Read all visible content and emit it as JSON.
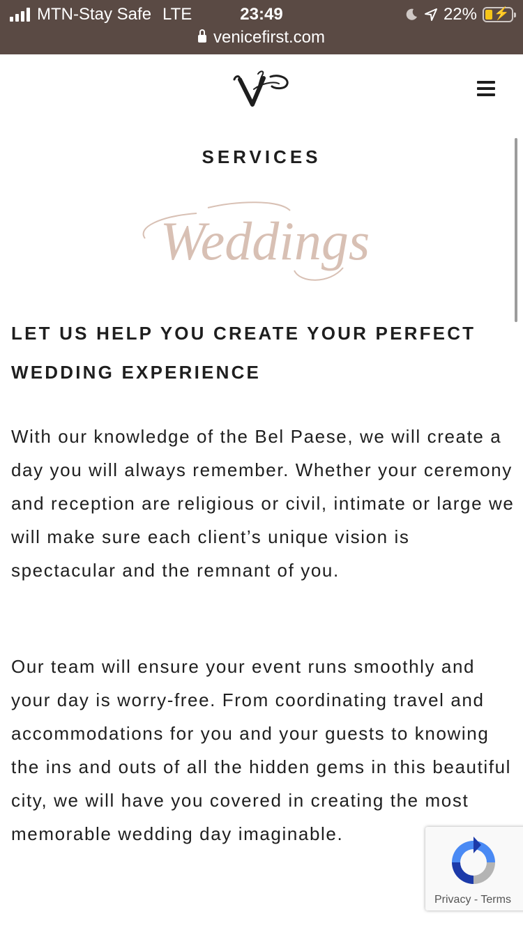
{
  "status_bar": {
    "carrier": "MTN-Stay Safe",
    "network": "LTE",
    "time": "23:49",
    "battery": "22%",
    "url": "venicefirst.com"
  },
  "header": {
    "logo_icon": "vf-monogram-logo",
    "menu_icon": "hamburger-menu-icon"
  },
  "content": {
    "section_label": "SERVICES",
    "script_title": "Weddings",
    "headline": "LET US HELP YOU CREATE YOUR PERFECT WEDDING EXPERIENCE",
    "paragraph_1": "With our knowledge of the Bel Paese, we will create a day you will always remember. Whether your ceremony and reception are religious or civil, intimate or large we will make sure each client’s unique vision is spectacular and the remnant of you.",
    "paragraph_2": "Our team will ensure your event runs smoothly and your day is worry-free. From coordinating travel and accommodations for you and your guests to knowing the ins and outs of all the hidden gems in this beautiful city, we will have you covered in creating the most memorable wedding day imaginable."
  },
  "recaptcha": {
    "privacy": "Privacy",
    "separator": "-",
    "terms": "Terms"
  },
  "colors": {
    "status_bar_bg": "#5a4a44",
    "script_title": "#d8c0b4",
    "text": "#1e1e1e",
    "battery_fill": "#f5c518"
  }
}
